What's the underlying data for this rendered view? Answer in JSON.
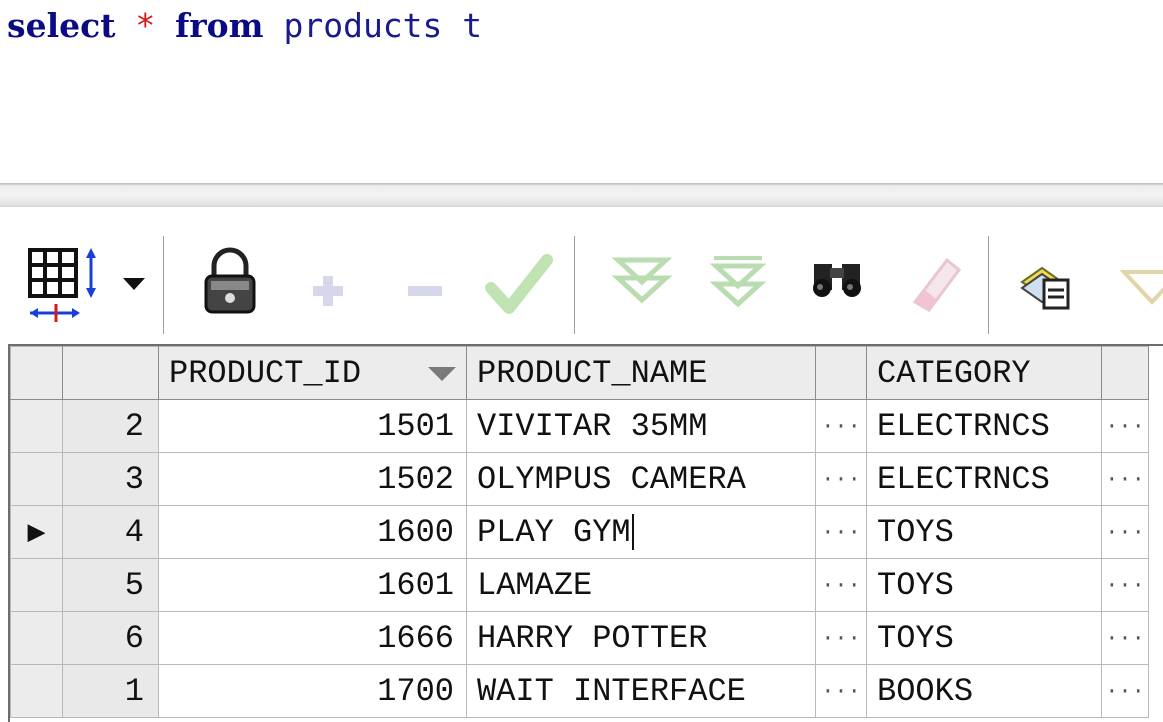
{
  "editor": {
    "sql_select": "select",
    "sql_star": "*",
    "sql_from": "from",
    "sql_rest": "products t"
  },
  "toolbar": {
    "icons": [
      "grid-select-icon",
      "lock-icon",
      "add-record-icon",
      "delete-record-icon",
      "post-changes-icon",
      "fetch-next-icon",
      "fetch-last-icon",
      "find-icon",
      "clear-icon",
      "export-icon",
      "filter-icon"
    ]
  },
  "grid": {
    "columns": [
      "PRODUCT_ID",
      "PRODUCT_NAME",
      "CATEGORY"
    ],
    "ellipsis": "···",
    "current_row_marker": "▶",
    "rows": [
      {
        "num": "2",
        "id": "1501",
        "name": "VIVITAR 35MM",
        "category": "ELECTRNCS"
      },
      {
        "num": "3",
        "id": "1502",
        "name": "OLYMPUS CAMERA",
        "category": "ELECTRNCS"
      },
      {
        "num": "4",
        "id": "1600",
        "name": "PLAY GYM",
        "category": "TOYS"
      },
      {
        "num": "5",
        "id": "1601",
        "name": "LAMAZE",
        "category": "TOYS"
      },
      {
        "num": "6",
        "id": "1666",
        "name": "HARRY POTTER",
        "category": "TOYS"
      },
      {
        "num": "1",
        "id": "1700",
        "name": "WAIT INTERFACE",
        "category": "BOOKS"
      }
    ]
  }
}
